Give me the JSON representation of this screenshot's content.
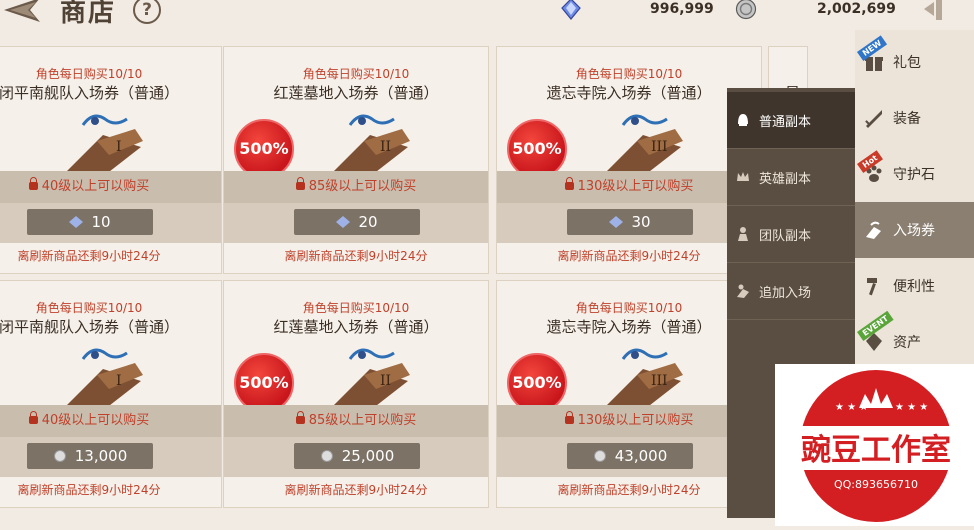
{
  "header": {
    "title": "商店",
    "help_label": "?",
    "currency_1": "996,999",
    "currency_2": "2,002,699"
  },
  "cards": [
    {
      "limit": "角色每日购买10/10",
      "name": "闭平南舰队入场券（普通）",
      "badge": "",
      "requirement": "40级以上可以购买",
      "price": "10",
      "refresh": "离刷新商品还剩9小时24分",
      "numeral": "I"
    },
    {
      "limit": "角色每日购买10/10",
      "name": "红莲墓地入场券（普通）",
      "badge": "500%",
      "requirement": "85级以上可以购买",
      "price": "20",
      "refresh": "离刷新商品还剩9小时24分",
      "numeral": "II"
    },
    {
      "limit": "角色每日购买10/10",
      "name": "遗忘寺院入场券（普通）",
      "badge": "500%",
      "requirement": "130级以上可以购买",
      "price": "30",
      "refresh": "离刷新商品还剩9小时24分",
      "numeral": "III"
    },
    {
      "limit": "角色每日购买10/10",
      "name": "闭平南舰队入场券（普通）",
      "badge": "",
      "requirement": "40级以上可以购买",
      "price": "13,000",
      "refresh": "离刷新商品还剩9小时24分",
      "numeral": "I"
    },
    {
      "limit": "角色每日购买10/10",
      "name": "红莲墓地入场券（普通）",
      "badge": "500%",
      "requirement": "85级以上可以购买",
      "price": "25,000",
      "refresh": "离刷新商品还剩9小时24分",
      "numeral": "II"
    },
    {
      "limit": "角色每日购买10/10",
      "name": "遗忘寺院入场券（普通）",
      "badge": "500%",
      "requirement": "130级以上可以购买",
      "price": "43,000",
      "refresh": "离刷新商品还剩9小时24分",
      "numeral": "III"
    }
  ],
  "partial_card_text": "星",
  "submenu": [
    "普通副本",
    "英雄副本",
    "团队副本",
    "追加入场"
  ],
  "right_menu": [
    {
      "label": "礼包",
      "tag": "NEW"
    },
    {
      "label": "装备",
      "tag": ""
    },
    {
      "label": "守护石",
      "tag": "Hot"
    },
    {
      "label": "入场券",
      "tag": ""
    },
    {
      "label": "便利性",
      "tag": ""
    },
    {
      "label": "资产",
      "tag": "EVENT"
    }
  ],
  "watermark": {
    "name": "豌豆工作室",
    "contact": "QQ:893656710"
  },
  "colors": {
    "accent_red": "#c0412b",
    "submenu_bg": "#5a4e43",
    "active_tab": "#8b7f71"
  }
}
